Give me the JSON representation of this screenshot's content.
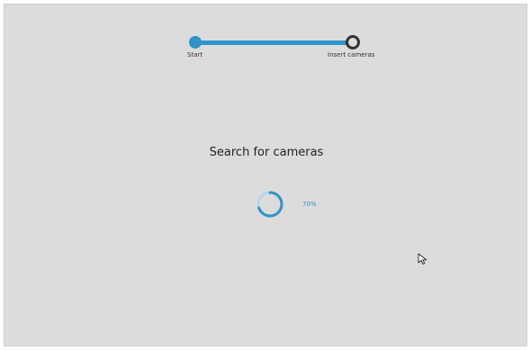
{
  "stepper": {
    "steps": [
      {
        "label": "Start",
        "state": "completed"
      },
      {
        "label": "Insert cameras",
        "state": "current"
      }
    ]
  },
  "main": {
    "title": "Search for cameras",
    "progress_percent_text": "70%",
    "progress_fraction": 0.7
  },
  "colors": {
    "accent": "#2f94c8",
    "background": "#dcdcdc",
    "text": "#222222"
  },
  "icons": {
    "spinner": "loading-spinner-icon",
    "cursor": "mouse-pointer-icon"
  }
}
